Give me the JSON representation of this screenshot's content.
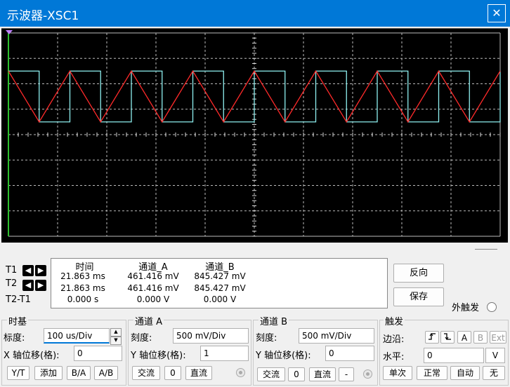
{
  "window": {
    "title": "示波器-XSC1",
    "close_glyph": "✕"
  },
  "scope": {
    "grid_divisions": {
      "x": 10,
      "y": 8
    },
    "background_color": "#000000",
    "grid_color": "#bbbbbb",
    "channel_a_color": "#8ef0f0",
    "channel_b_color": "#ff2a2a",
    "channel_a_trace": "square",
    "channel_b_trace": "triangle",
    "cycles_visible": 8
  },
  "cursors": {
    "t1_label": "T1",
    "t2_label": "T2",
    "t21_label": "T2-T1",
    "left_arrow": "◀",
    "right_arrow": "▶"
  },
  "readout": {
    "headers": [
      "时间",
      "通道_A",
      "通道_B"
    ],
    "rows": [
      [
        "21.863 ms",
        "461.416 mV",
        "845.427 mV"
      ],
      [
        "21.863 ms",
        "461.416 mV",
        "845.427 mV"
      ],
      [
        "0.000 s",
        "0.000 V",
        "0.000 V"
      ]
    ]
  },
  "actions": {
    "reverse": "反向",
    "save": "保存",
    "ext_trigger": "外触发"
  },
  "timebase": {
    "group": "时基",
    "scale_label": "标度:",
    "scale_value": "100 us/Div",
    "xpos_label": "X 轴位移(格):",
    "xpos_value": "0",
    "modes": [
      "Y/T",
      "添加",
      "B/A",
      "A/B"
    ]
  },
  "channel_a": {
    "group": "通道 A",
    "scale_label": "刻度:",
    "scale_value": "500 mV/Div",
    "ypos_label": "Y 轴位移(格):",
    "ypos_value": "1",
    "ac": "交流",
    "zero": "0",
    "dc": "直流"
  },
  "channel_b": {
    "group": "通道 B",
    "scale_label": "刻度:",
    "scale_value": "500 mV/Div",
    "ypos_label": "Y 轴位移(格):",
    "ypos_value": "0",
    "ac": "交流",
    "zero": "0",
    "dc": "直流",
    "minus": "-"
  },
  "trigger": {
    "group": "触发",
    "edge_label": "边沿:",
    "level_label": "水平:",
    "level_value": "0",
    "level_unit": "V",
    "sources": [
      "A",
      "B",
      "Ext"
    ],
    "modes": [
      "单次",
      "正常",
      "自动",
      "无"
    ]
  }
}
